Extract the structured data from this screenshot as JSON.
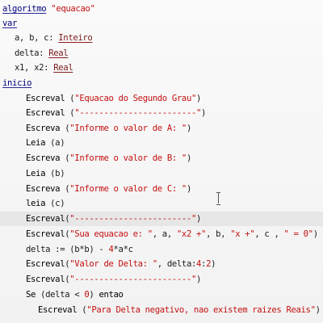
{
  "editor": {
    "lines": {
      "l1": {
        "kw": "algoritmo",
        "str": "\"equacao\""
      },
      "l2": {
        "kw": "var"
      },
      "l3": {
        "vars": "a, b, c: ",
        "type": "Inteiro"
      },
      "l4": {
        "vars": "delta: ",
        "type": "Real"
      },
      "l5": {
        "vars": "x1, x2: ",
        "type": "Real"
      },
      "l6": {
        "kw": "inicio"
      },
      "l7": {
        "cmd": "Escreval",
        "open": " (",
        "str": "\"Equacao do Segundo Grau\"",
        "close": ")"
      },
      "l8": {
        "cmd": "Escreval",
        "open": " (",
        "str": "\"------------------------\"",
        "close": ")"
      },
      "l9": {
        "cmd": "Escreva",
        "open": " (",
        "str": "\"Informe o valor de A: \"",
        "close": ")"
      },
      "l10": {
        "cmd": "Leia",
        "rest": " (a)"
      },
      "l11": {
        "cmd": "Escreva",
        "open": " (",
        "str": "\"Informe o valor de B: \"",
        "close": ")"
      },
      "l12": {
        "cmd": "Leia",
        "rest": " (b)"
      },
      "l13": {
        "cmd": "Escreva",
        "open": " (",
        "str": "\"Informe o valor de C: \"",
        "close": ")"
      },
      "l14": {
        "cmd": "leia",
        "rest": " (c)"
      },
      "l15": {
        "cmd": "Escreval",
        "open": "(",
        "str": "\"------------------------\"",
        "close": ")"
      },
      "l16": {
        "cmd": "Escreval",
        "open": "(",
        "s1": "\"Sua equacao e: \"",
        "p1": ", a, ",
        "s2": "\"x2 +\"",
        "p2": ", b, ",
        "s3": "\"x +\"",
        "p3": ", c , ",
        "s4": "\" = 0\"",
        "close": ")"
      },
      "l17": {
        "pre": "delta := (b*b) - ",
        "n1": "4",
        "post": "*a*c"
      },
      "l18": {
        "cmd": "Escreval",
        "open": "(",
        "str": "\"Valor de Delta: \"",
        "mid": ", delta:",
        "n1": "4",
        "colon": ":",
        "n2": "2",
        "close": ")"
      },
      "l19": {
        "cmd": "Escreval",
        "open": "(",
        "str": "\"------------------------\"",
        "close": ")"
      },
      "l20": {
        "kw": "Se",
        "pre": " (delta < ",
        "n1": "0",
        "post": ") ",
        "kw2": "entao"
      },
      "l21": {
        "cmd": "Escreval",
        "open": " (",
        "str": "\"Para Delta negativo, nao existem raizes Reais\"",
        "close": ")"
      }
    }
  }
}
